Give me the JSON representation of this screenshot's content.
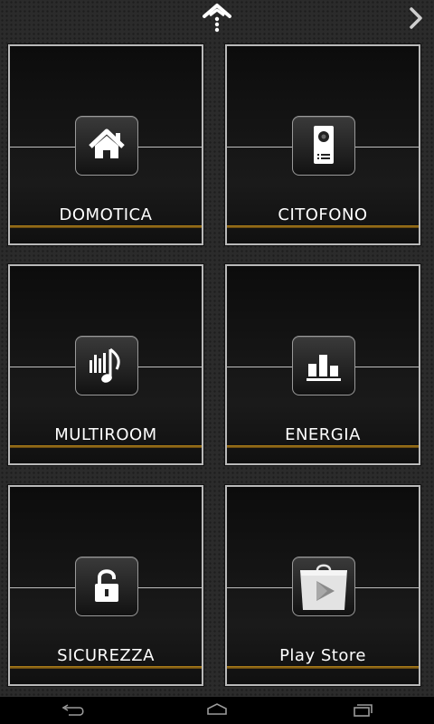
{
  "tiles": [
    {
      "label": "DOMOTICA",
      "icon": "house-icon"
    },
    {
      "label": "CITOFONO",
      "icon": "intercom-icon"
    },
    {
      "label": "MULTIROOM",
      "icon": "music-icon"
    },
    {
      "label": "ENERGIA",
      "icon": "bar-chart-icon"
    },
    {
      "label": "SICUREZZA",
      "icon": "padlock-icon"
    },
    {
      "label": "Play Store",
      "icon": "play-store-icon"
    }
  ],
  "topbar": {
    "home_icon": "home-icon",
    "next_icon": "chevron-right-icon"
  },
  "navbar": {
    "back_icon": "back-icon",
    "home_icon": "home-outline-icon",
    "recents_icon": "recent-apps-icon"
  },
  "colors": {
    "accent_gold": "#b8861a",
    "tile_border": "#b9b9b9",
    "background": "#2b2b2b"
  }
}
